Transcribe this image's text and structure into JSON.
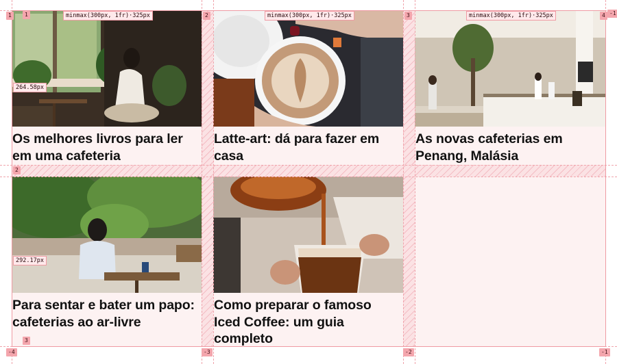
{
  "grid_overlay": {
    "column_sizes": [
      "minmax(300px, 1fr)·325px",
      "minmax(300px, 1fr)·325px",
      "minmax(300px, 1fr)·325px"
    ],
    "row_sizes": [
      "264.58px",
      "292.17px"
    ],
    "column_line_numbers_top": [
      "1",
      "2",
      "3",
      "4"
    ],
    "column_line_numbers_bottom": [
      "-4",
      "-3",
      "-2",
      "-1"
    ],
    "row_line_numbers_left": [
      "1",
      "2",
      "3"
    ],
    "row_line_number_right_top": "-1",
    "colors": {
      "line": "#ef9aa3",
      "badge": "#f4a6ad",
      "area": "#fdf2f2"
    }
  },
  "cards": [
    {
      "title": "Os melhores livros para ler em uma cafeteria",
      "image": "woman-reading-in-cafe"
    },
    {
      "title": "Latte-art: dá para fazer em casa",
      "image": "latte-art-cup"
    },
    {
      "title": "As novas cafeterias em Penang, Malásia",
      "image": "cafe-interior"
    },
    {
      "title": "Para sentar e bater um papo: cafeterias ao ar-livre",
      "image": "outdoor-cafe-woman"
    },
    {
      "title": "Como preparar o famoso Iced Coffee: um guia completo",
      "image": "iced-coffee-pour"
    }
  ]
}
